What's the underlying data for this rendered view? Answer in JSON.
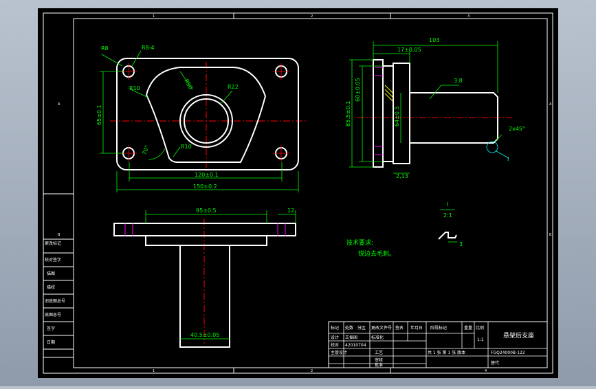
{
  "colors": {
    "background": "#000000",
    "outline": "#ffffff",
    "dimension": "#00ff00",
    "centerline": "#ff0000",
    "hidden": "#ff00ff",
    "leader": "#00ffff",
    "weld": "#ffff00",
    "frame": "#ffffff"
  },
  "border": {
    "col_numbers": [
      "1",
      "2",
      "3",
      "4"
    ],
    "row_letters": [
      "A",
      "B"
    ]
  },
  "top_view": {
    "r8": "R8",
    "r84": "R8-4",
    "r10a": "R10",
    "r50": "R50",
    "r22": "R22",
    "r10b": "R10",
    "angle": "70°",
    "dim_120": "120±0.1",
    "dim_150": "150±0.2",
    "dim_65": "65±0.1"
  },
  "side_view": {
    "dim_103": "103",
    "dim_17": "17±0.05",
    "dim_60": "60±0.05",
    "dim_85_5": "85.5±0.1",
    "dim_64": "64±0.5",
    "weld": "3.8",
    "chamfer": "2x45°",
    "dim_2_13": "2,13",
    "detail": "I"
  },
  "front_view": {
    "dim_95": "95±0.5",
    "dim_12": "12",
    "dim_40_5": "40.5±0.05"
  },
  "detail_view": {
    "label_top": "I",
    "label_scale": "2:1",
    "dim_3": "3"
  },
  "notes": {
    "title": "技术要求:",
    "line1": "锐边去毛刺。"
  },
  "left_strip": [
    "更改标记",
    "校对签字",
    "描图",
    "描校",
    "旧底图总号",
    "底图总号",
    "签字",
    "日期"
  ],
  "title_block": {
    "h_mark": "标记",
    "h_count": "处数",
    "h_zone": "分区",
    "h_change": "更改文件号",
    "h_sign": "签名",
    "h_date": "年月日",
    "h_stage": "阶段标记",
    "h_weight": "重量",
    "h_scale": "比例",
    "design": "设计",
    "std": "标准化",
    "proof": "校对",
    "process": "工艺",
    "chief": "主管设计",
    "review": "审核",
    "approve": "批准",
    "designer": "王振国",
    "date": "42010704",
    "scale_val": "1:1",
    "title": "悬架后支座",
    "drawing_no": "FGQ24000B-122",
    "sheet": "共 1 张  第 1 张  版本",
    "replace": "替代"
  }
}
